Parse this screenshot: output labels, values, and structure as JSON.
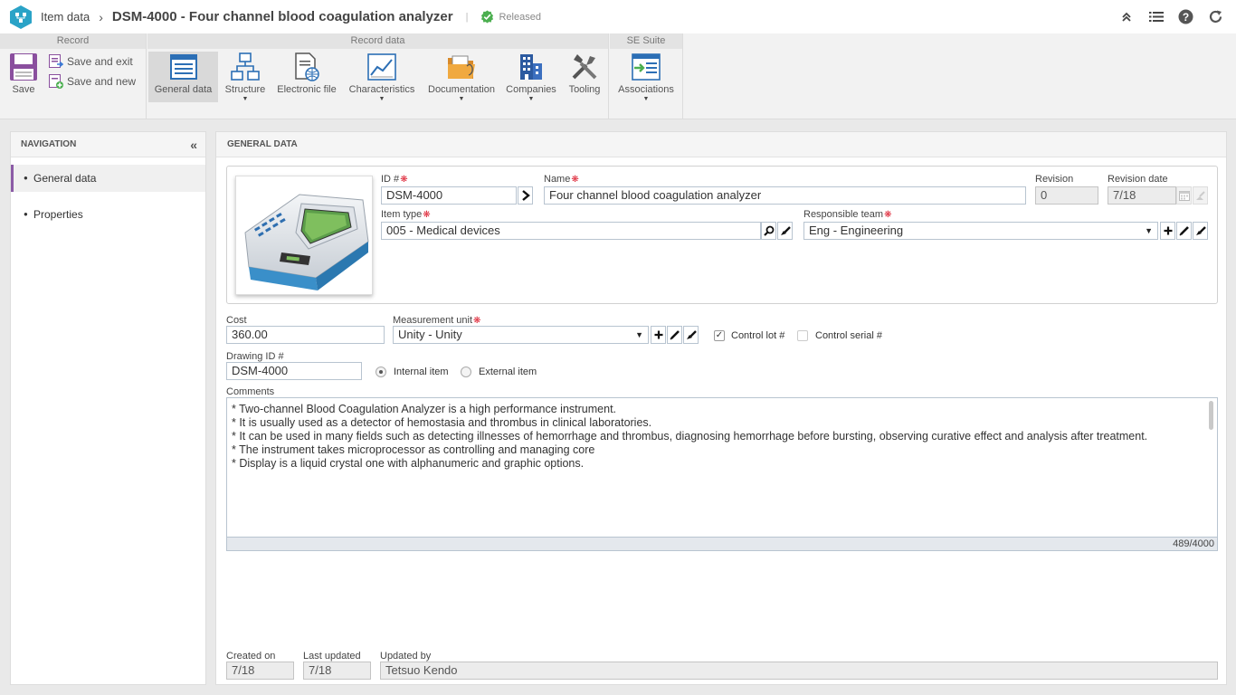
{
  "header": {
    "breadcrumb": "Item data",
    "title": "DSM-4000 - Four channel blood coagulation analyzer",
    "divider": "|",
    "status": "Released",
    "status_color": "#4caf50",
    "accent_color": "#2aa3c7"
  },
  "ribbon": {
    "groups": {
      "record": "Record",
      "record_data": "Record data",
      "se_suite": "SE Suite"
    },
    "save": "Save",
    "save_and_exit": "Save and exit",
    "save_and_new": "Save and new",
    "general_data": "General data",
    "structure": "Structure",
    "electronic_file": "Electronic file",
    "characteristics": "Characteristics",
    "documentation": "Documentation",
    "companies": "Companies",
    "tooling": "Tooling",
    "associations": "Associations"
  },
  "navigation": {
    "title": "NAVIGATION",
    "items": [
      {
        "label": "General data",
        "active": true
      },
      {
        "label": "Properties",
        "active": false
      }
    ]
  },
  "general": {
    "title": "GENERAL DATA",
    "id_label": "ID #",
    "id_value": "DSM-4000",
    "name_label": "Name",
    "name_value": "Four channel blood coagulation analyzer",
    "revision_label": "Revision",
    "revision_value": "0",
    "revision_date_label": "Revision date",
    "revision_date_value": "7/18",
    "item_type_label": "Item type",
    "item_type_value": "005 - Medical devices",
    "responsible_team_label": "Responsible team",
    "responsible_team_value": "Eng - Engineering",
    "cost_label": "Cost",
    "cost_value": "360.00",
    "measurement_unit_label": "Measurement unit",
    "measurement_unit_value": "Unity - Unity",
    "control_lot_label": "Control lot #",
    "control_lot_checked": true,
    "control_serial_label": "Control serial #",
    "control_serial_checked": false,
    "drawing_id_label": "Drawing ID #",
    "drawing_id_value": "DSM-4000",
    "internal_item_label": "Internal item",
    "external_item_label": "External item",
    "item_origin_selected": "Internal item",
    "comments_label": "Comments",
    "comments_lines": [
      "* Two-channel Blood Coagulation Analyzer is a high performance instrument.",
      "* It is usually used as a detector of hemostasia and thrombus in clinical laboratories.",
      "* It can be used in many fields such as detecting illnesses of hemorrhage and thrombus, diagnosing hemorrhage before bursting, observing curative effect and analysis after treatment.",
      "* The instrument takes microprocessor as controlling and managing core",
      "* Display is a liquid crystal one with alphanumeric and graphic options."
    ],
    "comments_counter": "489/4000",
    "created_on_label": "Created on",
    "created_on_value": "7/18",
    "last_updated_label": "Last updated",
    "last_updated_value": "7/18",
    "updated_by_label": "Updated by",
    "updated_by_value": "Tetsuo Kendo"
  }
}
